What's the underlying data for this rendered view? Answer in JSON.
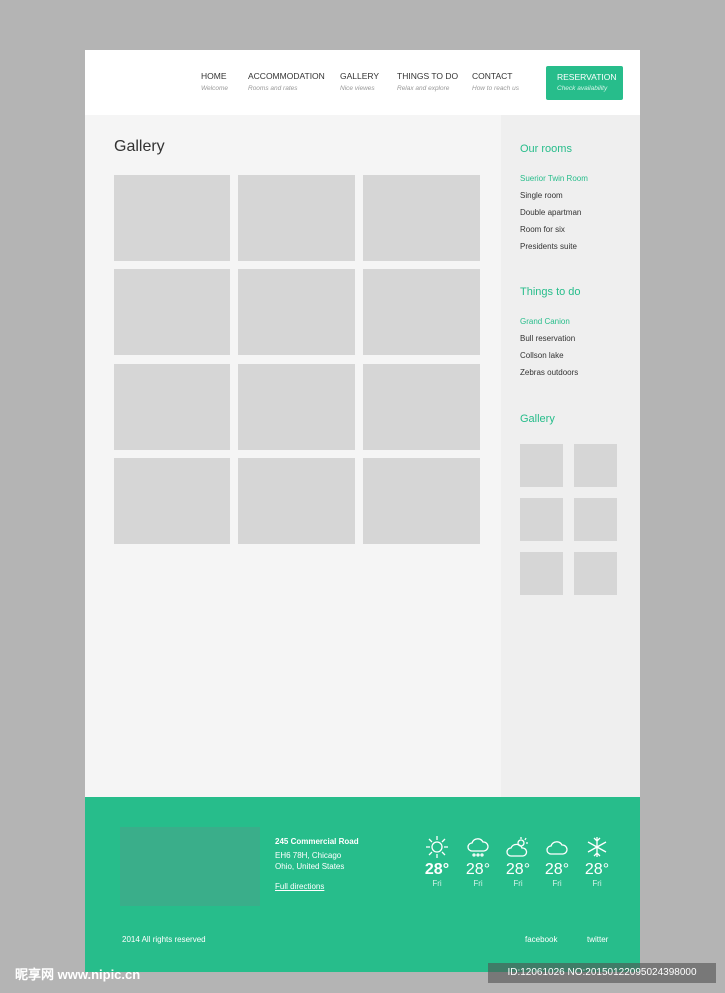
{
  "nav": [
    {
      "title": "HOME",
      "sub": "Welcome"
    },
    {
      "title": "ACCOMMODATION",
      "sub": "Rooms and rates"
    },
    {
      "title": "GALLERY",
      "sub": "Nice viewes"
    },
    {
      "title": "THINGS TO DO",
      "sub": "Relax and explore"
    },
    {
      "title": "CONTACT",
      "sub": "How to reach us"
    }
  ],
  "reservation": {
    "title": "RESERVATION",
    "sub": "Check availability"
  },
  "main": {
    "title": "Gallery"
  },
  "sidebar": {
    "rooms_title": "Our rooms",
    "rooms": [
      "Suerior Twin Room",
      "Single room",
      "Double apartman",
      "Room for six",
      "Presidents suite"
    ],
    "things_title": "Things to do",
    "things": [
      "Grand Canion",
      "Bull reservation",
      "Collson lake",
      "Zebras outdoors"
    ],
    "gallery_title": "Gallery"
  },
  "footer": {
    "address": [
      "245 Commercial Road",
      "EH6 78H, Chicago",
      "Ohio, United States"
    ],
    "directions": "Full directions",
    "weather": [
      {
        "icon": "sun-icon",
        "temp": "28°",
        "day": "Fri"
      },
      {
        "icon": "rain-cloud-icon",
        "temp": "28°",
        "day": "Fri"
      },
      {
        "icon": "sun-cloud-icon",
        "temp": "28°",
        "day": "Fri"
      },
      {
        "icon": "cloud-icon",
        "temp": "28°",
        "day": "Fri"
      },
      {
        "icon": "snowflake-icon",
        "temp": "28°",
        "day": "Fri"
      }
    ],
    "copyright": "2014 All rights reserved",
    "facebook": "facebook",
    "twitter": "twitter"
  },
  "colors": {
    "accent": "#27bd8b",
    "map": "#3aae8a",
    "placeholder": "#d6d6d6"
  },
  "watermark": {
    "logo": "昵享网 www.nipic.cn",
    "id": "ID:12061026 NO:20150122095024398000"
  }
}
